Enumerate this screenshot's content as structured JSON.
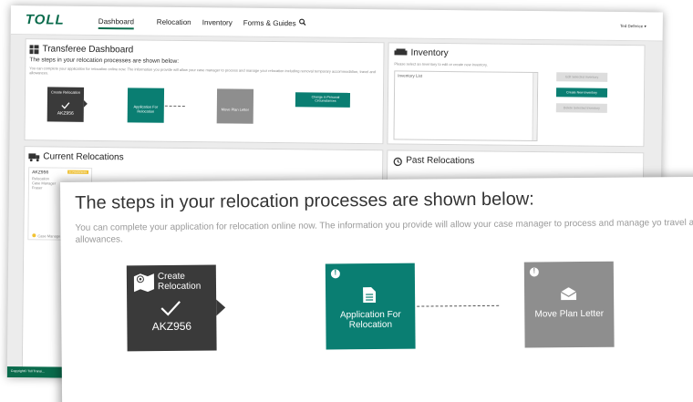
{
  "app": {
    "logo": "TOLL",
    "user_menu": "Ted Defence ▾",
    "footer": "Copyright© Toll Transi..."
  },
  "nav": {
    "items": [
      {
        "label": "Dashboard"
      },
      {
        "label": "Relocation"
      },
      {
        "label": "Inventory"
      },
      {
        "label": "Forms & Guides"
      }
    ]
  },
  "dashboard": {
    "title": "Transferee Dashboard",
    "subtitle": "The steps in your relocation processes are shown below:",
    "description": "You can complete your application for relocation online now. The information you provide will allow your case manager to process and manage your relocation including removal temporary accommodation, travel and allowances.",
    "change_button": "Change in Personal Circumstances",
    "steps": [
      {
        "title": "Create Relocation",
        "code": "AKZ956"
      },
      {
        "title": "Application For Relocation"
      },
      {
        "title": "Move Plan Letter"
      }
    ]
  },
  "inventory": {
    "title": "Inventory",
    "hint": "Please select an Inventory to edit or create new inventory.",
    "list_header": "Inventory List",
    "edit_button": "Edit Selected Inventory",
    "create_button": "Create New Inventory",
    "delete_button": "Delete Selected Inventory"
  },
  "current_relocations": {
    "title": "Current Relocations",
    "card_code": "AKZ956",
    "card_badge": "IN PROGRESS",
    "card_line1": "Relocation",
    "card_line2": "Case Manager",
    "card_line3": "Fraser",
    "card_status": "Case Manager"
  },
  "past_relocations": {
    "title": "Past Relocations"
  },
  "zoom": {
    "heading": "The steps in your relocation processes are shown below:",
    "description": "You can complete your application for relocation online now. The information you provide will allow your case manager to process and manage yo travel and allowances.",
    "step1_title": "Create Relocation",
    "step1_code": "AKZ956",
    "step2_title": "Application For Relocation",
    "step3_title": "Move Plan Letter",
    "alert_glyph": "!"
  },
  "colors": {
    "brand": "#0a6b4c",
    "teal": "#0a7e72",
    "dark_step": "#3a3a3a",
    "grey_step": "#8e8e8e"
  }
}
